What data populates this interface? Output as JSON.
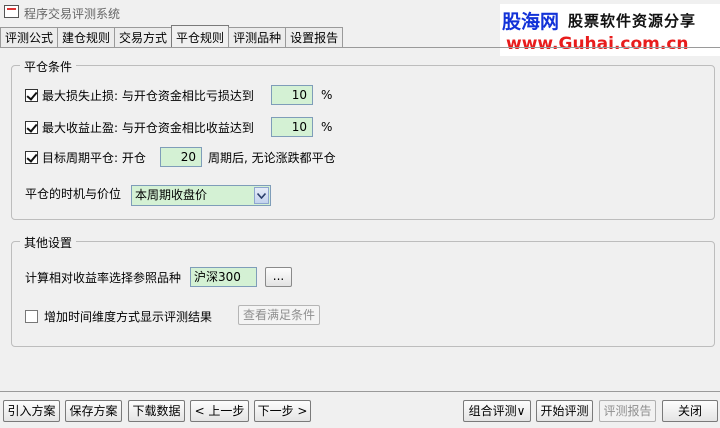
{
  "window": {
    "title": "程序交易评测系统"
  },
  "watermark": {
    "brand": "股海网",
    "slogan": "股票软件资源分享",
    "url": "www.Guhai.com.cn"
  },
  "tabs": [
    "评测公式",
    "建仓规则",
    "交易方式",
    "平仓规则",
    "评测品种",
    "设置报告"
  ],
  "active_tab": "平仓规则",
  "close_conditions": {
    "title": "平仓条件",
    "stop_loss": {
      "checked": true,
      "label": "最大损失止损: 与开仓资金相比亏损达到",
      "value": "10",
      "unit": "%"
    },
    "take_profit": {
      "checked": true,
      "label": "最大收益止盈: 与开仓资金相比收益达到",
      "value": "10",
      "unit": "%"
    },
    "target_period": {
      "checked": true,
      "label": "目标周期平仓: 开仓",
      "value": "20",
      "suffix": "周期后, 无论涨跌都平仓"
    },
    "timing_label": "平仓的时机与价位",
    "timing_value": "本周期收盘价"
  },
  "other_settings": {
    "title": "其他设置",
    "reference_label": "计算相对收益率选择参照品种",
    "reference_value": "沪深300",
    "browse_label": "...",
    "time_dimension": {
      "checked": false,
      "label": "增加时间维度方式显示评测结果"
    },
    "view_conditions_label": "查看满足条件"
  },
  "bottom_buttons": {
    "import": "引入方案",
    "save": "保存方案",
    "download": "下载数据",
    "prev": "< 上一步",
    "next": "下一步 >",
    "combo": "组合评测∨",
    "start": "开始评测",
    "report": "评测报告",
    "close": "关闭"
  }
}
